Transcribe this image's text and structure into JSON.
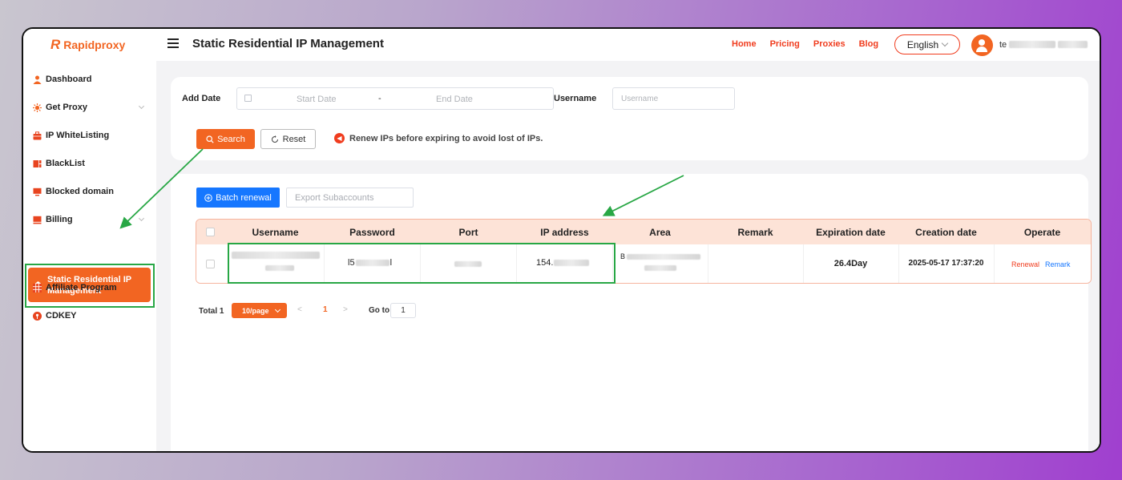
{
  "app": {
    "logo_mark": "R",
    "logo_text": "Rapidproxy",
    "title": "Static Residential IP Management"
  },
  "nav": {
    "home": "Home",
    "pricing": "Pricing",
    "proxies": "Proxies",
    "blog": "Blog"
  },
  "language": "English",
  "user": {
    "name_initial": "te"
  },
  "sidebar": {
    "items": [
      {
        "label": "Dashboard"
      },
      {
        "label": "Get Proxy"
      },
      {
        "label": "IP WhiteListing"
      },
      {
        "label": "BlackList"
      },
      {
        "label": "Blocked domain"
      },
      {
        "label": "Billing"
      },
      {
        "label": "Static Residential IP Management"
      },
      {
        "label": "Affiliate Program"
      },
      {
        "label": "CDKEY"
      }
    ]
  },
  "filters": {
    "add_date_label": "Add Date",
    "start_placeholder": "Start Date",
    "separator": "-",
    "end_placeholder": "End Date",
    "username_label": "Username",
    "username_placeholder": "Username",
    "search_label": "Search",
    "reset_label": "Reset",
    "notice": "Renew IPs before expiring to avoid lost of IPs."
  },
  "actions": {
    "batch_renewal": "Batch renewal",
    "export_placeholder": "Export Subaccounts"
  },
  "table": {
    "columns": [
      "Username",
      "Password",
      "Port",
      "IP address",
      "Area",
      "Remark",
      "Expiration date",
      "Creation date",
      "Operate"
    ],
    "rows": [
      {
        "username": "",
        "password_prefix": "l5",
        "password_suffix": "l",
        "port": "",
        "ip_prefix": "154.",
        "area_prefix": "B",
        "remark": "",
        "expiration": "26.4Day",
        "creation": "2025-05-17 17:37:20",
        "renewal": "Renewal",
        "remark_action": "Remark"
      }
    ]
  },
  "pagination": {
    "total": "Total 1",
    "page_size": "10/page",
    "current_page": "1",
    "goto_label": "Go to",
    "goto_value": "1"
  },
  "colors": {
    "accent": "#f26522",
    "link_red": "#f03c1e",
    "blue": "#1677ff",
    "highlight_green": "#28a745"
  }
}
